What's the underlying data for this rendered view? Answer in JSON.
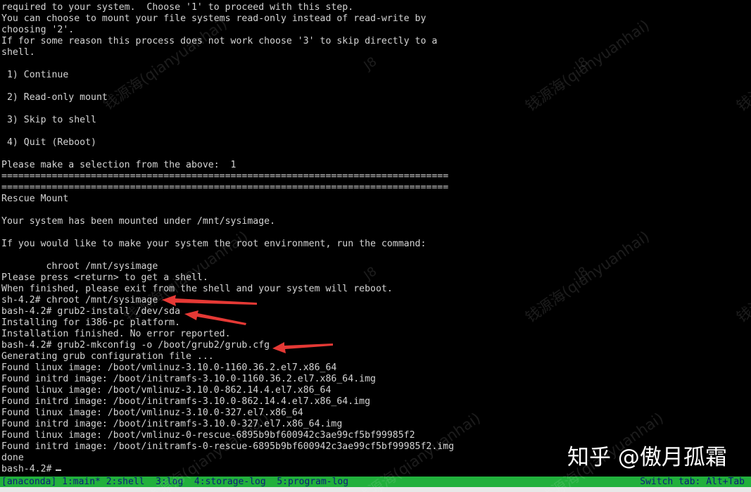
{
  "terminal": {
    "lines": [
      "required to your system.  Choose '1' to proceed with this step.",
      "You can choose to mount your file systems read-only instead of read-write by",
      "choosing '2'.",
      "If for some reason this process does not work choose '3' to skip directly to a",
      "shell.",
      "",
      " 1) Continue",
      "",
      " 2) Read-only mount",
      "",
      " 3) Skip to shell",
      "",
      " 4) Quit (Reboot)",
      "",
      "Please make a selection from the above:  1",
      "================================================================================",
      "================================================================================",
      "Rescue Mount",
      "",
      "Your system has been mounted under /mnt/sysimage.",
      "",
      "If you would like to make your system the root environment, run the command:",
      "",
      "        chroot /mnt/sysimage",
      "Please press <return> to get a shell.",
      "When finished, please exit from the shell and your system will reboot.",
      "sh-4.2# chroot /mnt/sysimage",
      "bash-4.2# grub2-install /dev/sda",
      "Installing for i386-pc platform.",
      "Installation finished. No error reported.",
      "bash-4.2# grub2-mkconfig -o /boot/grub2/grub.cfg",
      "Generating grub configuration file ...",
      "Found linux image: /boot/vmlinuz-3.10.0-1160.36.2.el7.x86_64",
      "Found initrd image: /boot/initramfs-3.10.0-1160.36.2.el7.x86_64.img",
      "Found linux image: /boot/vmlinuz-3.10.0-862.14.4.el7.x86_64",
      "Found initrd image: /boot/initramfs-3.10.0-862.14.4.el7.x86_64.img",
      "Found linux image: /boot/vmlinuz-3.10.0-327.el7.x86_64",
      "Found initrd image: /boot/initramfs-3.10.0-327.el7.x86_64.img",
      "Found linux image: /boot/vmlinuz-0-rescue-6895b9bf600942c3ae99cf5bf99985f2",
      "Found initrd image: /boot/initramfs-0-rescue-6895b9bf600942c3ae99cf5bf99985f2.img",
      "done",
      "bash-4.2# "
    ]
  },
  "statusbar": {
    "left": "[anaconda] 1:main* 2:shell  3:log  4:storage-log  5:program-log",
    "right": "Switch tab: Alt+Tab"
  },
  "watermark": {
    "text": "钱源海(qianyuanhai)",
    "sub": "J8"
  },
  "brand": "知乎 @傲月孤霜",
  "colors": {
    "terminal_bg": "#000000",
    "terminal_fg": "#d4d4d4",
    "statusbar_bg": "#21b03c",
    "statusbar_fg": "#0d1d7a",
    "arrow": "#e53935"
  }
}
